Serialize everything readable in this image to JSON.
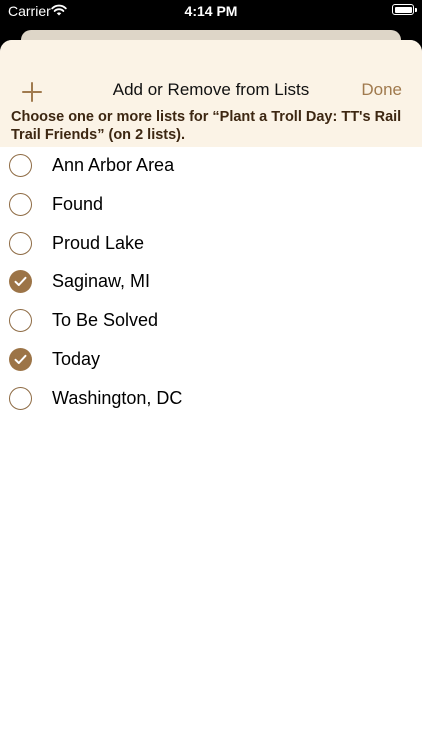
{
  "status_bar": {
    "carrier": "Carrier",
    "time": "4:14 PM"
  },
  "header": {
    "title": "Add or Remove from Lists",
    "done_label": "Done",
    "instructions": "Choose one or more lists for “Plant a Troll Day: TT's Rail Trail Friends” (on 2 lists)."
  },
  "lists": [
    {
      "label": "Ann Arbor Area",
      "checked": false
    },
    {
      "label": "Found",
      "checked": false
    },
    {
      "label": "Proud Lake",
      "checked": false
    },
    {
      "label": "Saginaw, MI",
      "checked": true
    },
    {
      "label": "To Be Solved",
      "checked": false
    },
    {
      "label": "Today",
      "checked": true
    },
    {
      "label": "Washington, DC",
      "checked": false
    }
  ],
  "colors": {
    "accent": "#a07a4e",
    "header_bg": "#fbf3e6",
    "checked_fill": "#9c7447"
  }
}
